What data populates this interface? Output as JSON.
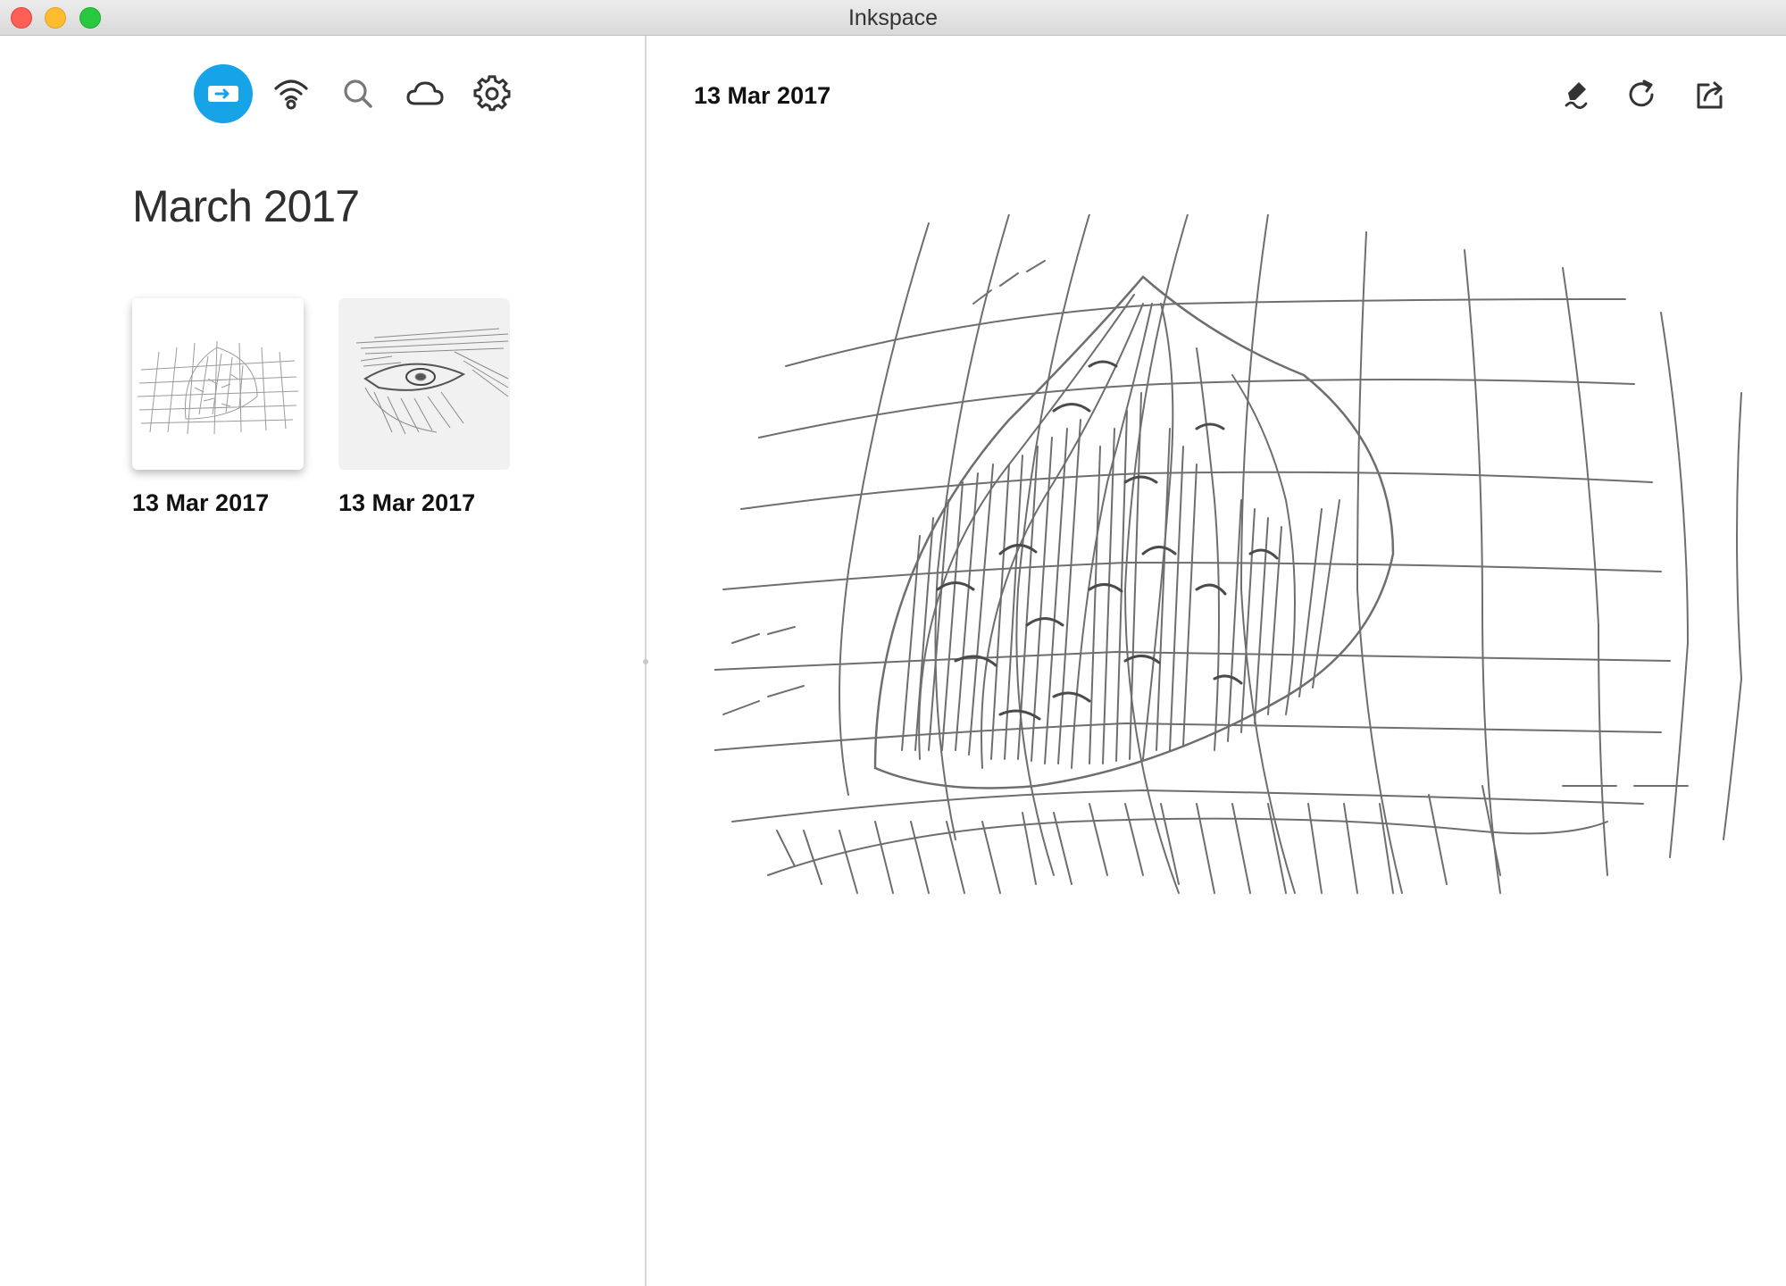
{
  "window": {
    "title": "Inkspace"
  },
  "sidebar": {
    "toolbar": [
      {
        "icon": "device-sync-icon",
        "active": true
      },
      {
        "icon": "wifi-icon",
        "active": false
      },
      {
        "icon": "search-icon",
        "active": false
      },
      {
        "icon": "cloud-icon",
        "active": false
      },
      {
        "icon": "gear-icon",
        "active": false
      }
    ],
    "section_title": "March 2017",
    "notes": [
      {
        "date": "13 Mar 2017",
        "thumbnail": "leaf-sketch",
        "selected": true
      },
      {
        "date": "13 Mar 2017",
        "thumbnail": "eye-sketch",
        "selected": false
      }
    ]
  },
  "main": {
    "date": "13 Mar 2017",
    "actions": [
      {
        "icon": "pen-edit-icon"
      },
      {
        "icon": "redo-icon"
      },
      {
        "icon": "share-icon"
      }
    ],
    "drawing": "leaf-sketch"
  },
  "colors": {
    "accent": "#16a3e8",
    "ink": "#6e6e6e",
    "text": "#111111"
  }
}
